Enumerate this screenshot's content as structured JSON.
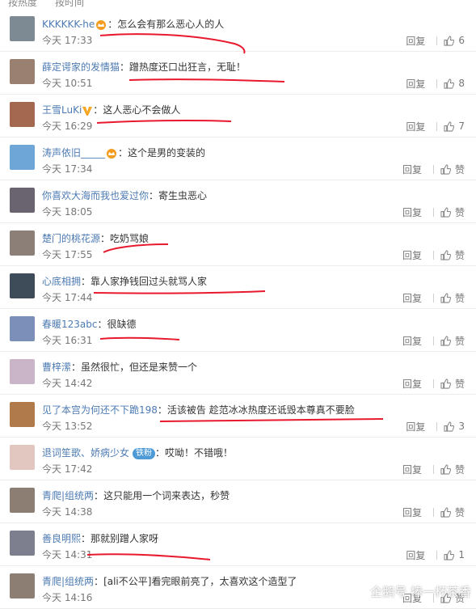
{
  "topbar": {
    "sort_hot": "按热度",
    "sort_time": "按时间"
  },
  "comments": [
    {
      "user": "KKKKKK-he",
      "text": "怎么会有那么恶心人的人",
      "time": "今天 17:33",
      "reply": "回复",
      "likes": "6",
      "avatar_color": "#7e8a93"
    },
    {
      "user": "薛定谔家的发情猫",
      "text": "蹭热度还口出狂言，无耻！",
      "time": "今天 10:51",
      "reply": "回复",
      "likes": "8",
      "avatar_color": "#9a8070"
    },
    {
      "user": "王雪LuKi",
      "text": "这人恶心不会做人",
      "time": "今天 16:29",
      "reply": "回复",
      "likes": "7",
      "avatar_color": "#a3684f"
    },
    {
      "user": "涛声依旧_____",
      "text": "这个是男的变装的",
      "time": "今天 17:34",
      "reply": "回复",
      "likes": "赞",
      "avatar_color": "#6ea6d8"
    },
    {
      "user": "你喜欢大海而我也爱过你",
      "text": "寄生虫恶心",
      "time": "今天 18:05",
      "reply": "回复",
      "likes": "赞",
      "avatar_color": "#6a6470"
    },
    {
      "user": "楚门的桃花源",
      "text": "吃奶骂娘",
      "time": "今天 17:55",
      "reply": "回复",
      "likes": "赞",
      "avatar_color": "#8c7f78"
    },
    {
      "user": "心底相拥",
      "text": "靠人家挣钱回过头就骂人家",
      "time": "今天 17:44",
      "reply": "回复",
      "likes": "赞",
      "avatar_color": "#3e4c5a"
    },
    {
      "user": "春暖123abc",
      "text": "很缺德",
      "time": "今天 16:31",
      "reply": "回复",
      "likes": "赞",
      "avatar_color": "#7c8fb8"
    },
    {
      "user": "曹梓潆",
      "text": "虽然很忙，但还是来赞一个",
      "time": "今天 14:42",
      "reply": "回复",
      "likes": "赞",
      "avatar_color": "#c9b4c8"
    },
    {
      "user": "见了本宫为何还不下跪198",
      "text": "活该被告 趁范冰冰热度还诋毁本尊真不要脸",
      "time": "今天 13:52",
      "reply": "回复",
      "likes": "3",
      "avatar_color": "#b07a4a"
    },
    {
      "user": "退词笙歌、娇病少女",
      "text": "哎呦！不错哦！",
      "time": "今天 17:42",
      "reply": "回复",
      "likes": "赞",
      "avatar_color": "#e2c7c1",
      "fan_badge": "铁粉"
    },
    {
      "user": "青爬|组统两",
      "text": "这只能用一个词来表达，秒赞",
      "time": "今天 14:38",
      "reply": "回复",
      "likes": "赞",
      "avatar_color": "#8d7e74"
    },
    {
      "user": "善良明熙",
      "text": "那就别蹭人家呀",
      "time": "今天 14:31",
      "reply": "回复",
      "likes": "1",
      "avatar_color": "#7e7f8e"
    },
    {
      "user": "青爬|组统两",
      "text": "[ali不公平]看完眼前亮了，太喜欢这个造型了",
      "time": "今天 14:16",
      "reply": "回复",
      "likes": "赞",
      "avatar_color": "#8d7e74"
    }
  ],
  "watermark": {
    "text": "企鹅号 捧一杯茶香"
  },
  "colors": {
    "username": "#4d7bb3",
    "underline": "#e8192c",
    "separator": "#ececec"
  }
}
